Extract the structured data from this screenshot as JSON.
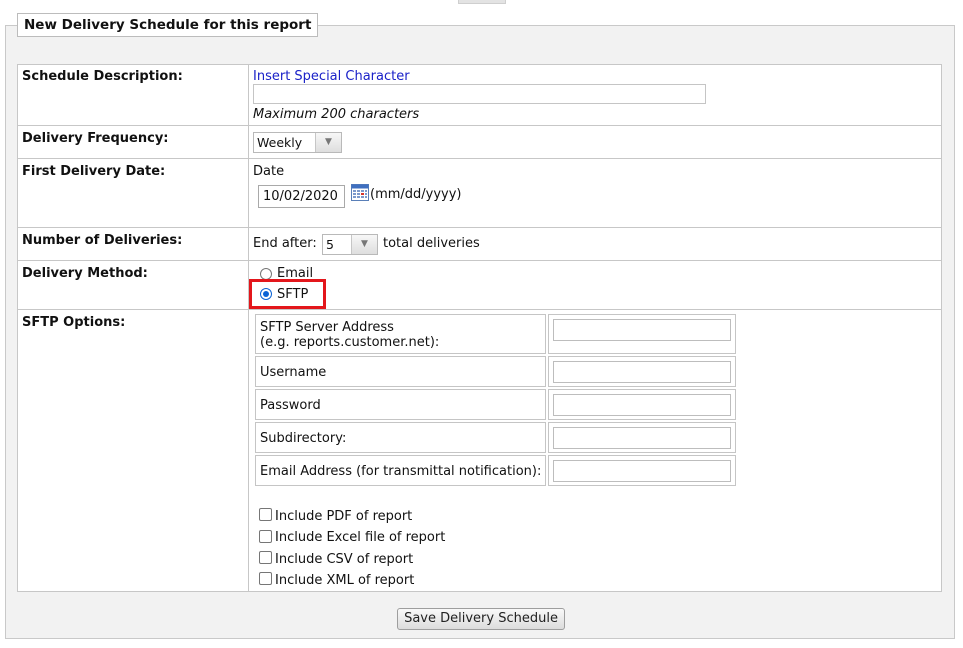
{
  "section": {
    "legend": "New Delivery Schedule for this report"
  },
  "schedule_description": {
    "label": "Schedule Description:",
    "special_char_link": "Insert Special Character",
    "value": "",
    "hint": "Maximum 200 characters"
  },
  "delivery_frequency": {
    "label": "Delivery Frequency:",
    "selected": "Weekly"
  },
  "first_delivery_date": {
    "label": "First Delivery Date:",
    "sublabel": "Date",
    "value": "10/02/2020",
    "format_hint": "(mm/dd/yyyy)",
    "icon": "calendar-icon"
  },
  "number_of_deliveries": {
    "label": "Number of Deliveries:",
    "prefix": "End after:",
    "selected": "5",
    "suffix": "total deliveries"
  },
  "delivery_method": {
    "label": "Delivery Method:",
    "options": [
      {
        "label": "Email",
        "checked": false
      },
      {
        "label": "SFTP",
        "checked": true
      }
    ],
    "highlight_color": "#e3161b"
  },
  "sftp_options": {
    "label": "SFTP Options:",
    "fields": [
      {
        "line1": "SFTP Server Address",
        "line2": "(e.g. reports.customer.net):",
        "value": ""
      },
      {
        "line1": "Username",
        "line2": "",
        "value": ""
      },
      {
        "line1": "Password",
        "line2": "",
        "value": ""
      },
      {
        "line1": "Subdirectory:",
        "line2": "",
        "value": ""
      },
      {
        "line1": "Email Address (for transmittal notification):",
        "line2": "",
        "value": ""
      }
    ],
    "checkboxes": [
      {
        "label": "Include PDF of report",
        "checked": false
      },
      {
        "label": "Include Excel file of report",
        "checked": false
      },
      {
        "label": "Include CSV of report",
        "checked": false
      },
      {
        "label": "Include XML of report",
        "checked": false
      }
    ]
  },
  "actions": {
    "save_label": "Save Delivery Schedule"
  }
}
